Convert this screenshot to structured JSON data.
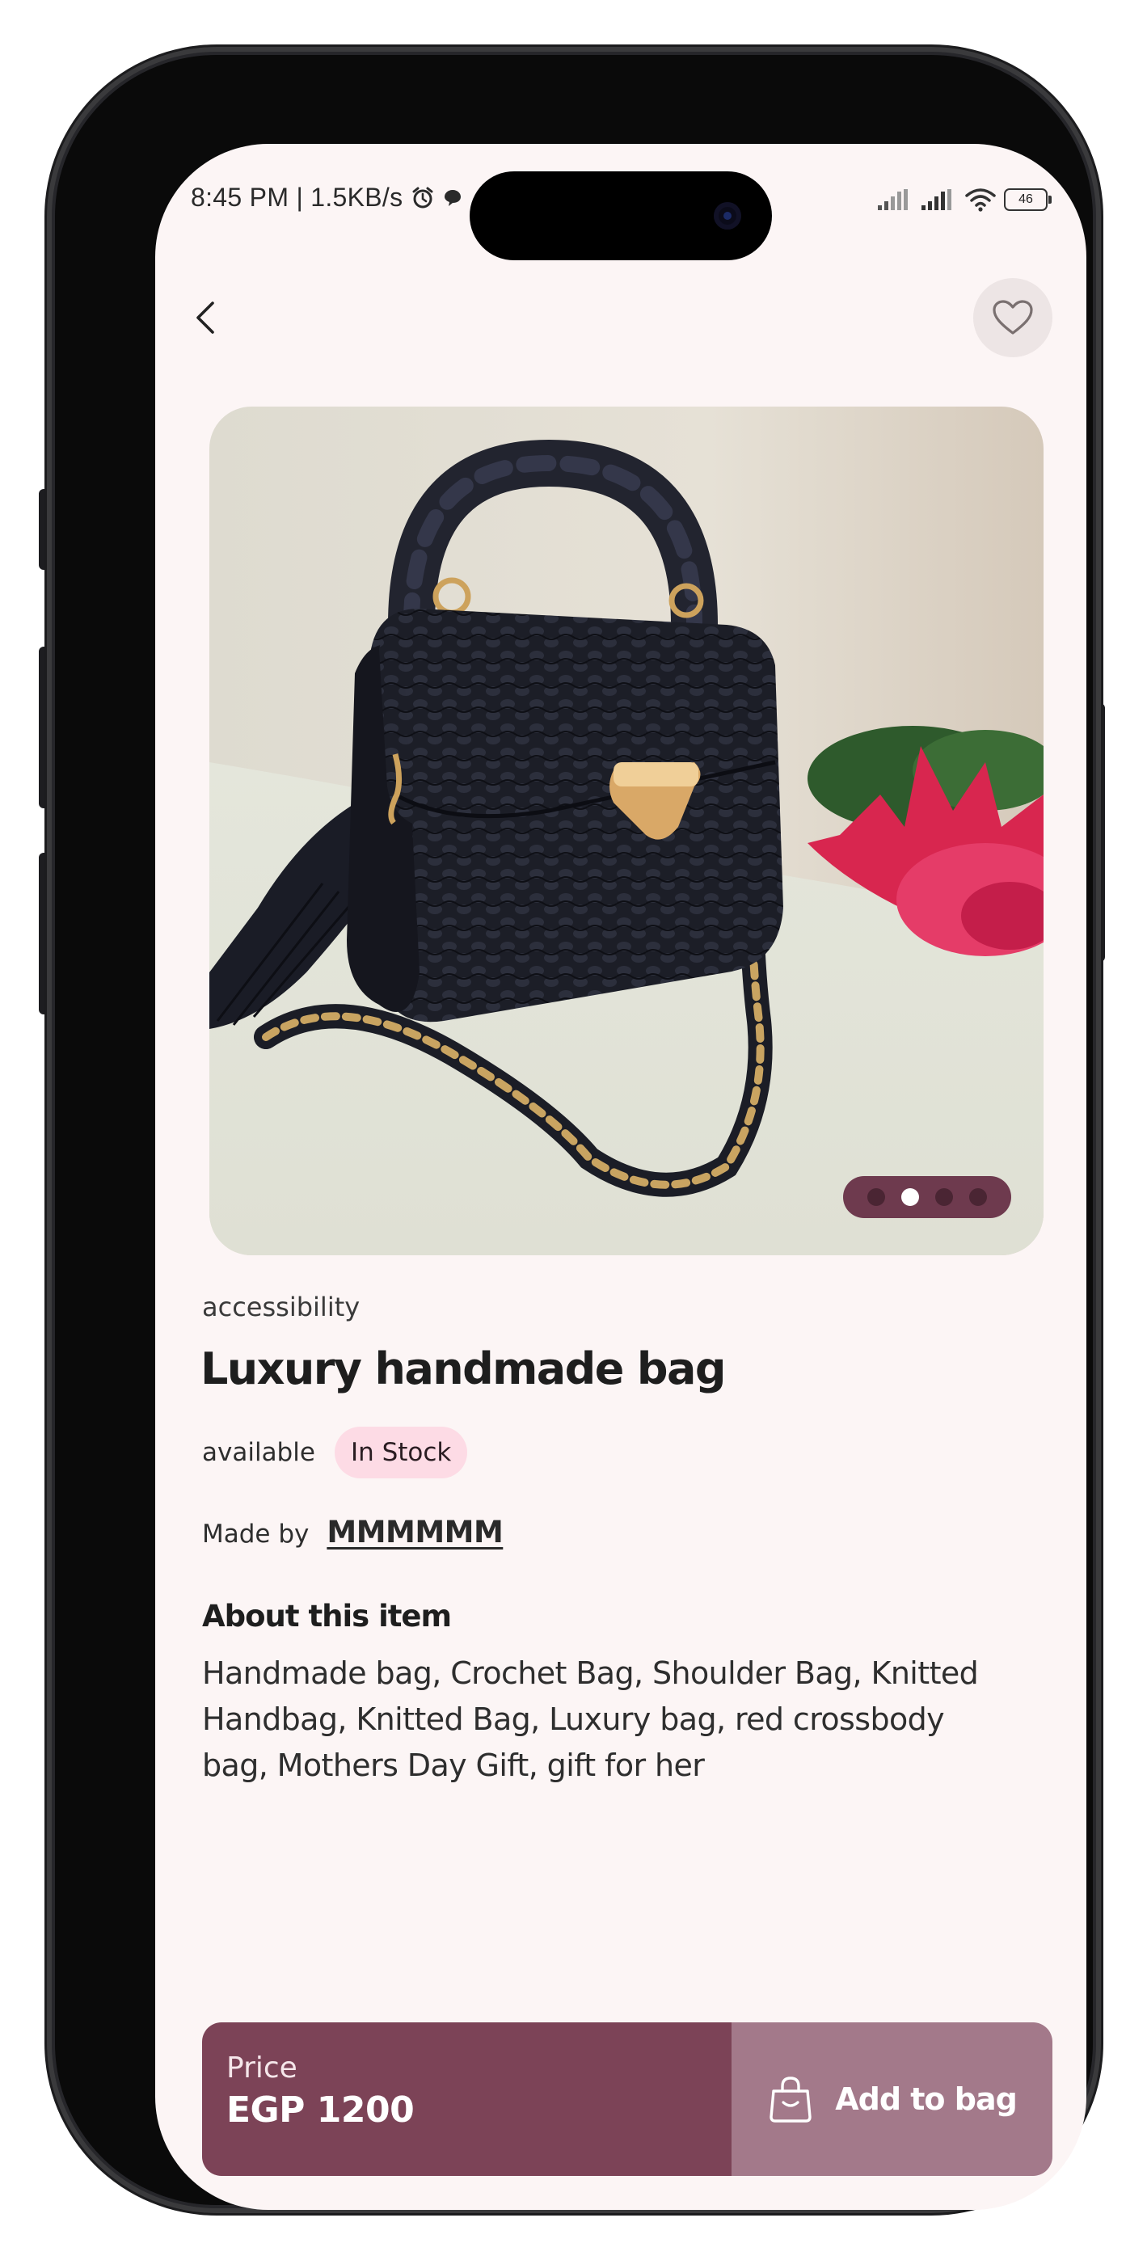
{
  "status_bar": {
    "time_speed": "8:45 PM | 1.5KB/s",
    "battery": "46"
  },
  "nav": {
    "back_icon": "chevron-left-icon",
    "favorite_icon": "heart-outline-icon"
  },
  "product": {
    "image_description_icon": "product-photo",
    "carousel": {
      "count": 4,
      "active_index": 1
    },
    "category": "accessibility",
    "title": "Luxury handmade bag",
    "availability_label": "available",
    "stock_status": "In Stock",
    "maker_label": "Made by",
    "maker_name": "MMMMMM",
    "about_heading": "About this item",
    "description": "Handmade bag, Crochet Bag, Shoulder Bag, Knitted Handbag, Knitted Bag, Luxury bag, red crossbody bag, Mothers Day Gift, gift for her"
  },
  "purchase": {
    "price_label": "Price",
    "price_value": "EGP 1200",
    "add_to_bag_label": "Add to bag",
    "bag_icon": "shopping-bag-icon"
  },
  "colors": {
    "background": "#fcf5f5",
    "price_panel": "#7c4357",
    "add_button": "#a3798a",
    "stock_badge": "#fddbe5",
    "carousel_pill": "#6e3a4e"
  }
}
